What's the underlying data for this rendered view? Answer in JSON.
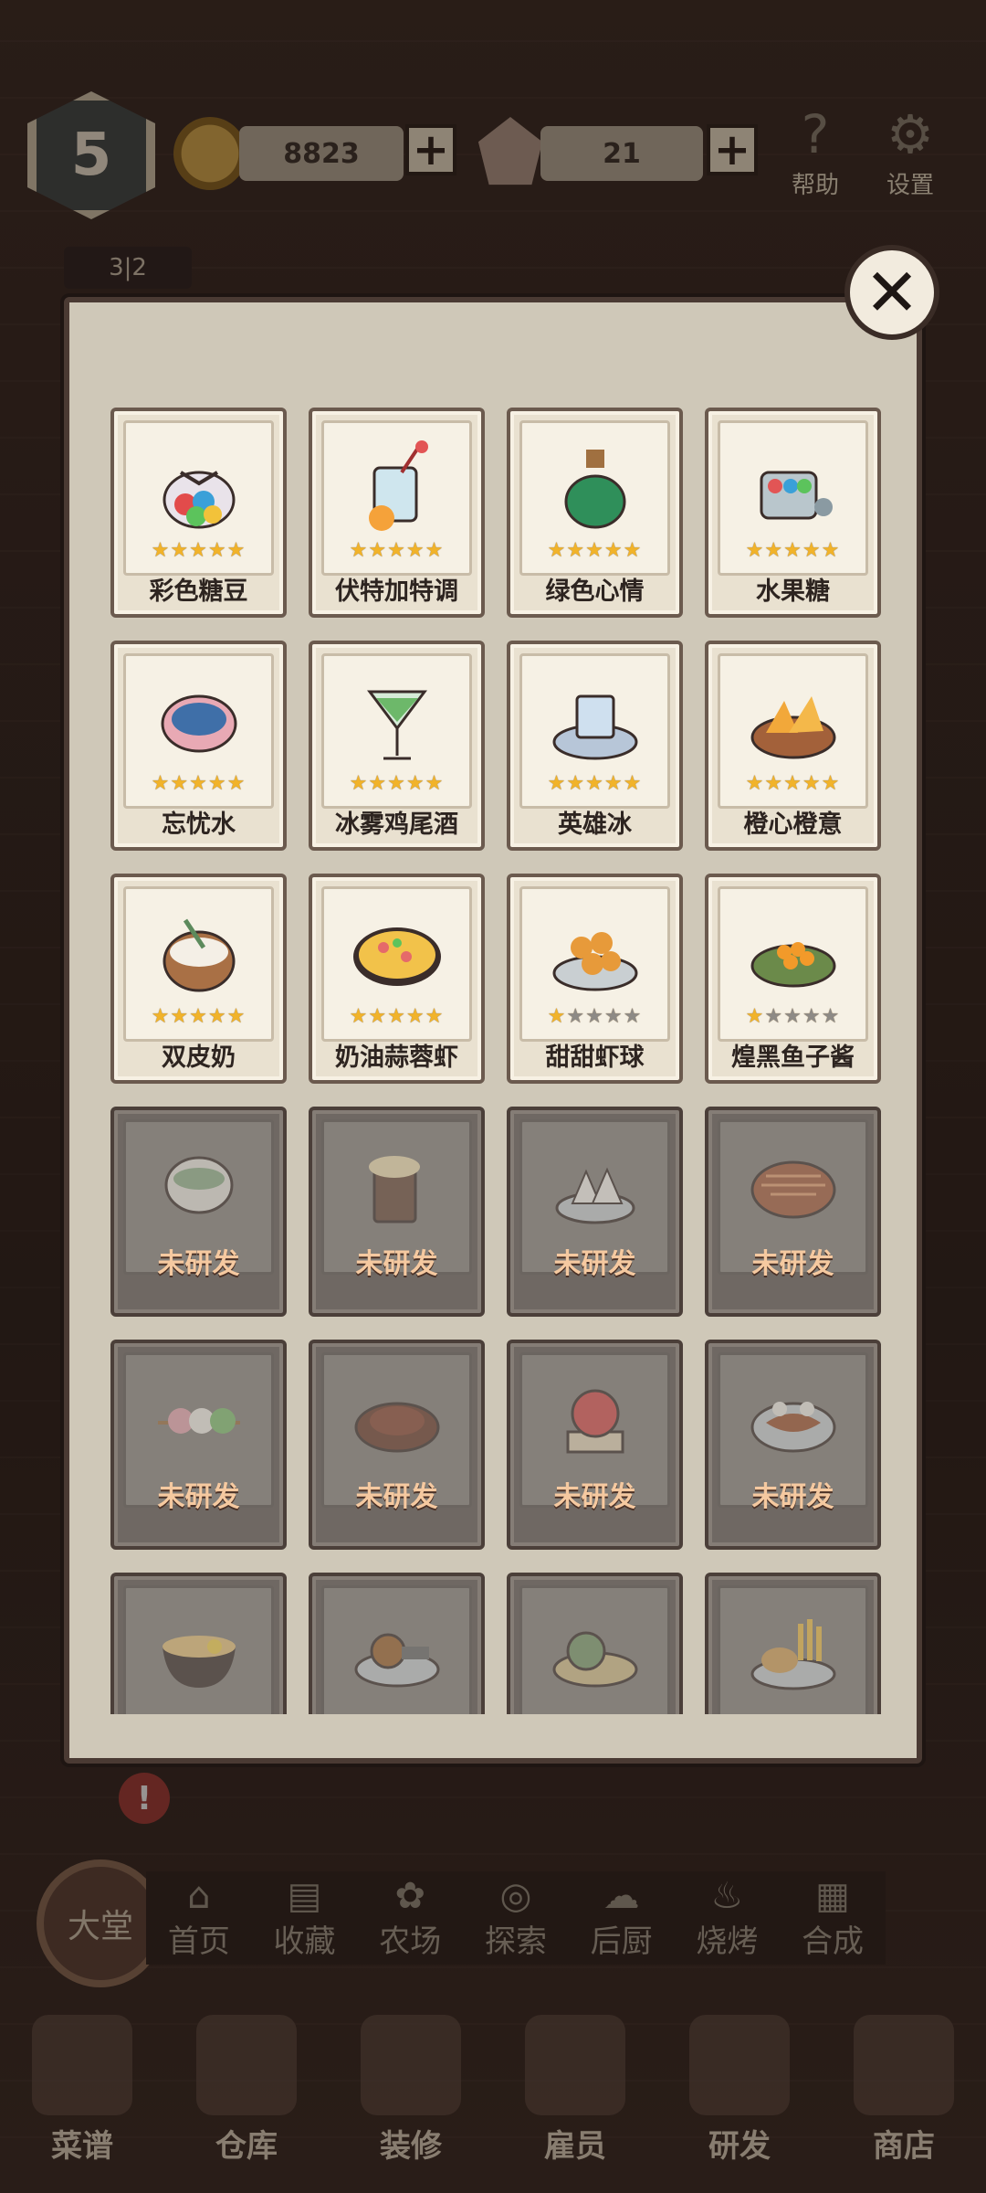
{
  "hud": {
    "level": "5",
    "coins": "8823",
    "gems": "21",
    "plus": "+",
    "help_label": "帮助",
    "settings_label": "设置",
    "mini_counter": "3|2"
  },
  "panel": {
    "close_symbol": "✕",
    "recipes": [
      {
        "name": "彩色糖豆",
        "stars": 5,
        "locked": false,
        "icon": "candy-bag-icon"
      },
      {
        "name": "伏特加特调",
        "stars": 5,
        "locked": false,
        "icon": "cocktail-glass-icon"
      },
      {
        "name": "绿色心情",
        "stars": 5,
        "locked": false,
        "icon": "green-potion-icon"
      },
      {
        "name": "水果糖",
        "stars": 5,
        "locked": false,
        "icon": "candy-jar-icon"
      },
      {
        "name": "忘忧水",
        "stars": 5,
        "locked": false,
        "icon": "blue-water-icon"
      },
      {
        "name": "冰雾鸡尾酒",
        "stars": 5,
        "locked": false,
        "icon": "martini-icon"
      },
      {
        "name": "英雄冰",
        "stars": 5,
        "locked": false,
        "icon": "ice-cube-icon"
      },
      {
        "name": "橙心橙意",
        "stars": 5,
        "locked": false,
        "icon": "orange-slices-icon"
      },
      {
        "name": "双皮奶",
        "stars": 5,
        "locked": false,
        "icon": "milk-pudding-icon"
      },
      {
        "name": "奶油蒜蓉虾",
        "stars": 5,
        "locked": false,
        "icon": "garlic-shrimp-icon"
      },
      {
        "name": "甜甜虾球",
        "stars": 1,
        "locked": false,
        "icon": "shrimp-balls-icon"
      },
      {
        "name": "煌黑鱼子酱",
        "stars": 1,
        "locked": false,
        "icon": "caviar-icon"
      },
      {
        "name": "未研发",
        "locked": true,
        "icon": "tea-cup-icon"
      },
      {
        "name": "未研发",
        "locked": true,
        "icon": "beer-mug-icon"
      },
      {
        "name": "未研发",
        "locked": true,
        "icon": "rice-ball-icon"
      },
      {
        "name": "未研发",
        "locked": true,
        "icon": "pie-icon"
      },
      {
        "name": "未研发",
        "locked": true,
        "icon": "dango-icon"
      },
      {
        "name": "未研发",
        "locked": true,
        "icon": "meat-plate-icon"
      },
      {
        "name": "未研发",
        "locked": true,
        "icon": "tomato-dish-icon"
      },
      {
        "name": "未研发",
        "locked": true,
        "icon": "noodle-plate-icon"
      },
      {
        "name": "",
        "locked": true,
        "icon": "ramen-bowl-icon"
      },
      {
        "name": "",
        "locked": true,
        "icon": "gear-dish-icon"
      },
      {
        "name": "",
        "locked": true,
        "icon": "lotus-dish-icon"
      },
      {
        "name": "",
        "locked": true,
        "icon": "fries-chicken-icon"
      }
    ]
  },
  "nav": {
    "main": "大堂",
    "items": [
      "首页",
      "收藏",
      "农场",
      "探索",
      "后厨",
      "烧烤",
      "合成"
    ]
  },
  "bottom": {
    "items": [
      "菜谱",
      "仓库",
      "装修",
      "雇员",
      "研发",
      "商店"
    ]
  },
  "colors": {
    "star_on": "#f1b32a",
    "star_off": "#8d8a86",
    "locked_text": "#f5c9a0"
  }
}
